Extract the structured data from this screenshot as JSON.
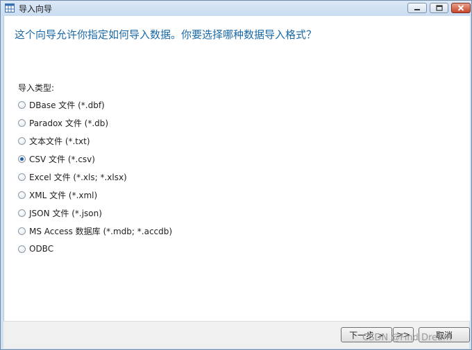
{
  "window": {
    "title": "导入向导",
    "minimize_icon": "minimize-icon",
    "maximize_icon": "maximize-icon",
    "close_icon": "close-icon"
  },
  "page": {
    "heading": "这个向导允许你指定如何导入数据。你要选择哪种数据导入格式？",
    "group_label": "导入类型:",
    "selected_index": 3,
    "options": [
      {
        "label": "DBase 文件 (*.dbf)",
        "checked": false
      },
      {
        "label": "Paradox 文件 (*.db)",
        "checked": false
      },
      {
        "label": "文本文件 (*.txt)",
        "checked": false
      },
      {
        "label": "CSV 文件 (*.csv)",
        "checked": true
      },
      {
        "label": "Excel 文件 (*.xls; *.xlsx)",
        "checked": false
      },
      {
        "label": "XML 文件 (*.xml)",
        "checked": false
      },
      {
        "label": "JSON 文件 (*.json)",
        "checked": false
      },
      {
        "label": "MS Access 数据库 (*.mdb; *.accdb)",
        "checked": false
      },
      {
        "label": "ODBC",
        "checked": false
      }
    ]
  },
  "footer": {
    "next_label": "下一步 >",
    "last_label": ">>",
    "cancel_label": "取消"
  },
  "watermark": "CSDN @Find Dream",
  "colors": {
    "heading": "#1b69a6",
    "titlebar": "#c9dcf0",
    "close": "#c7452b"
  }
}
